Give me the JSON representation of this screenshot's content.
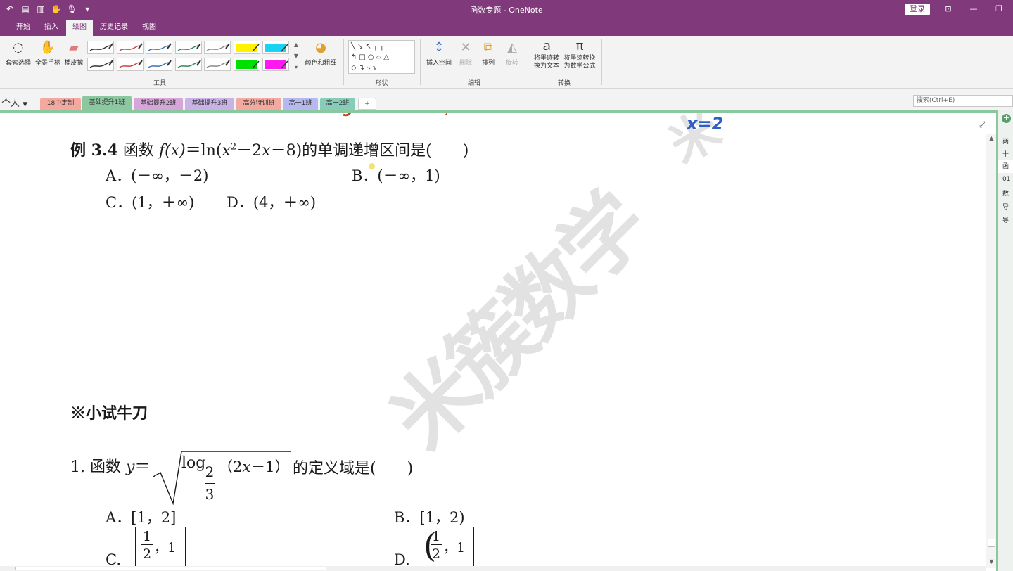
{
  "window": {
    "title": "函数专题 - OneNote",
    "login_label": "登录"
  },
  "ribbon_tabs": [
    "开始",
    "插入",
    "绘图",
    "历史记录",
    "视图"
  ],
  "ribbon": {
    "lasso_label": "套索选择",
    "pan_label": "全景手柄",
    "eraser_label": "橡皮擦",
    "color_label": "颜色和粗细",
    "tools_group": "工具",
    "shapes_group": "形状",
    "insert_space_label": "插入空间",
    "delete_label": "删除",
    "arrange_label": "排列",
    "rotate_label": "旋转",
    "edit_group": "编辑",
    "ink_to_text_label_1": "将墨迹转",
    "ink_to_text_label_2": "换为文本",
    "ink_to_math_label_1": "将墨迹转换",
    "ink_to_math_label_2": "为数学公式",
    "convert_group": "转换",
    "pen_colors": [
      "#333333",
      "#d23a3a",
      "#3a6fb0",
      "#2e8a55",
      "#888888",
      "#fff200",
      "#19d3f2",
      "#333333",
      "#d23a3a",
      "#3a6fb0",
      "#2e8a55",
      "#888888",
      "#00e000",
      "#ff19f0"
    ]
  },
  "notebook": {
    "name": "个人",
    "sections": [
      {
        "label": "18中定制",
        "color": "#f3a9a0"
      },
      {
        "label": "基础提升1班",
        "color": "#8bc79f"
      },
      {
        "label": "基础提升2班",
        "color": "#d6a6db"
      },
      {
        "label": "基础提升3班",
        "color": "#c9b3e6"
      },
      {
        "label": "高分特训班",
        "color": "#f3a9a0"
      },
      {
        "label": "高一1班",
        "color": "#b6b9f0"
      },
      {
        "label": "高一2班",
        "color": "#87cbb9"
      }
    ],
    "add_section": "+",
    "search_placeholder": "搜索(Ctrl+E)"
  },
  "page": {
    "example_label": "例 3.4",
    "example_text_1": " 函数 ",
    "example_func": "f(x)",
    "example_text_2": "＝ln(",
    "example_var": "x",
    "example_sup": "2",
    "example_text_3": "－2",
    "example_var2": "x",
    "example_text_4": "－8)的单调递增区间是(　　)",
    "opt_a": "A．(－∞，－2)",
    "opt_b": "B．(－∞，1)",
    "opt_c": "C．(1，＋∞)",
    "opt_d": "D．(4，＋∞)",
    "section_heading": "※小试牛刀",
    "q1_num": "1.",
    "q1_text_1": " 函数 ",
    "q1_var": "y",
    "q1_text_2": "＝",
    "q1_log": "log",
    "q1_base_num": "2",
    "q1_base_den": "3",
    "q1_arg": "（2",
    "q1_argx": "x",
    "q1_arg2": "－1）",
    "q1_text_3": "的定义域是(　　)",
    "q1_opt_a": "A．[1，2]",
    "q1_opt_b": "B．[1，2)",
    "q1_opt_c": "C.",
    "q1_opt_d": "D.",
    "frac_num": "1",
    "frac_den": "2",
    "frac_right": "，1",
    "watermark": "米簇数学",
    "ink_annotation": "x=2"
  },
  "page_list": [
    "两",
    "十",
    "函",
    "01",
    "数",
    "导",
    "导"
  ],
  "page_list_selected": 2
}
